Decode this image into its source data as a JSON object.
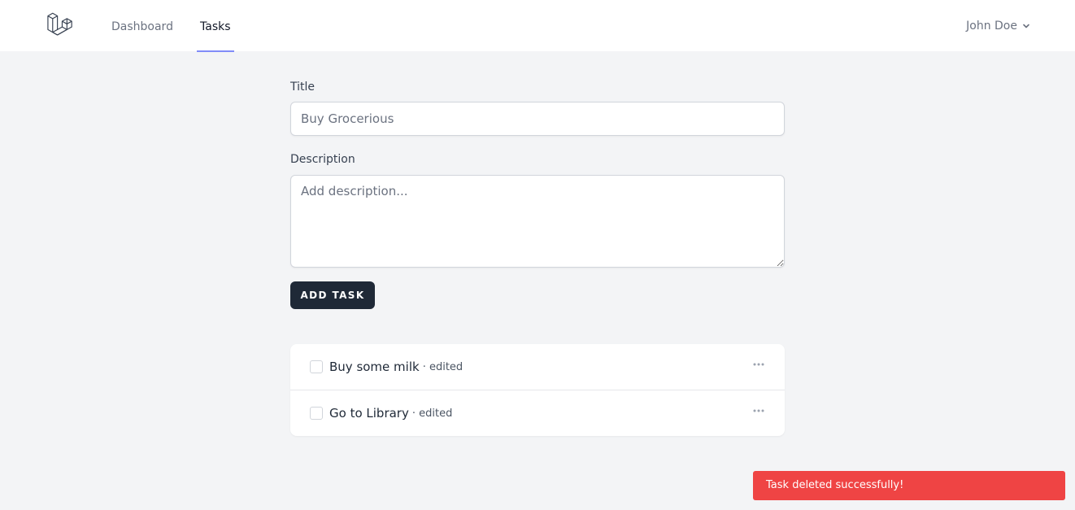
{
  "nav": {
    "logo_icon": "laravel-logo-icon",
    "links": [
      {
        "label": "Dashboard",
        "active": false
      },
      {
        "label": "Tasks",
        "active": true
      }
    ],
    "user": {
      "name": "John Doe",
      "icon": "chevron-down-icon"
    },
    "active_color": "#818cf8"
  },
  "form": {
    "title_label": "Title",
    "title_value": "Buy Grocerious",
    "description_label": "Description",
    "description_placeholder": "Add description...",
    "submit_label": "ADD TASK"
  },
  "tasks": [
    {
      "title": "Buy some milk",
      "meta": "· edited",
      "checked": false,
      "menu_icon": "more-horizontal-icon"
    },
    {
      "title": "Go to Library",
      "meta": "· edited",
      "checked": false,
      "menu_icon": "more-horizontal-icon"
    }
  ],
  "toast": {
    "message": "Task deleted successfully!",
    "color": "#ef4444"
  }
}
